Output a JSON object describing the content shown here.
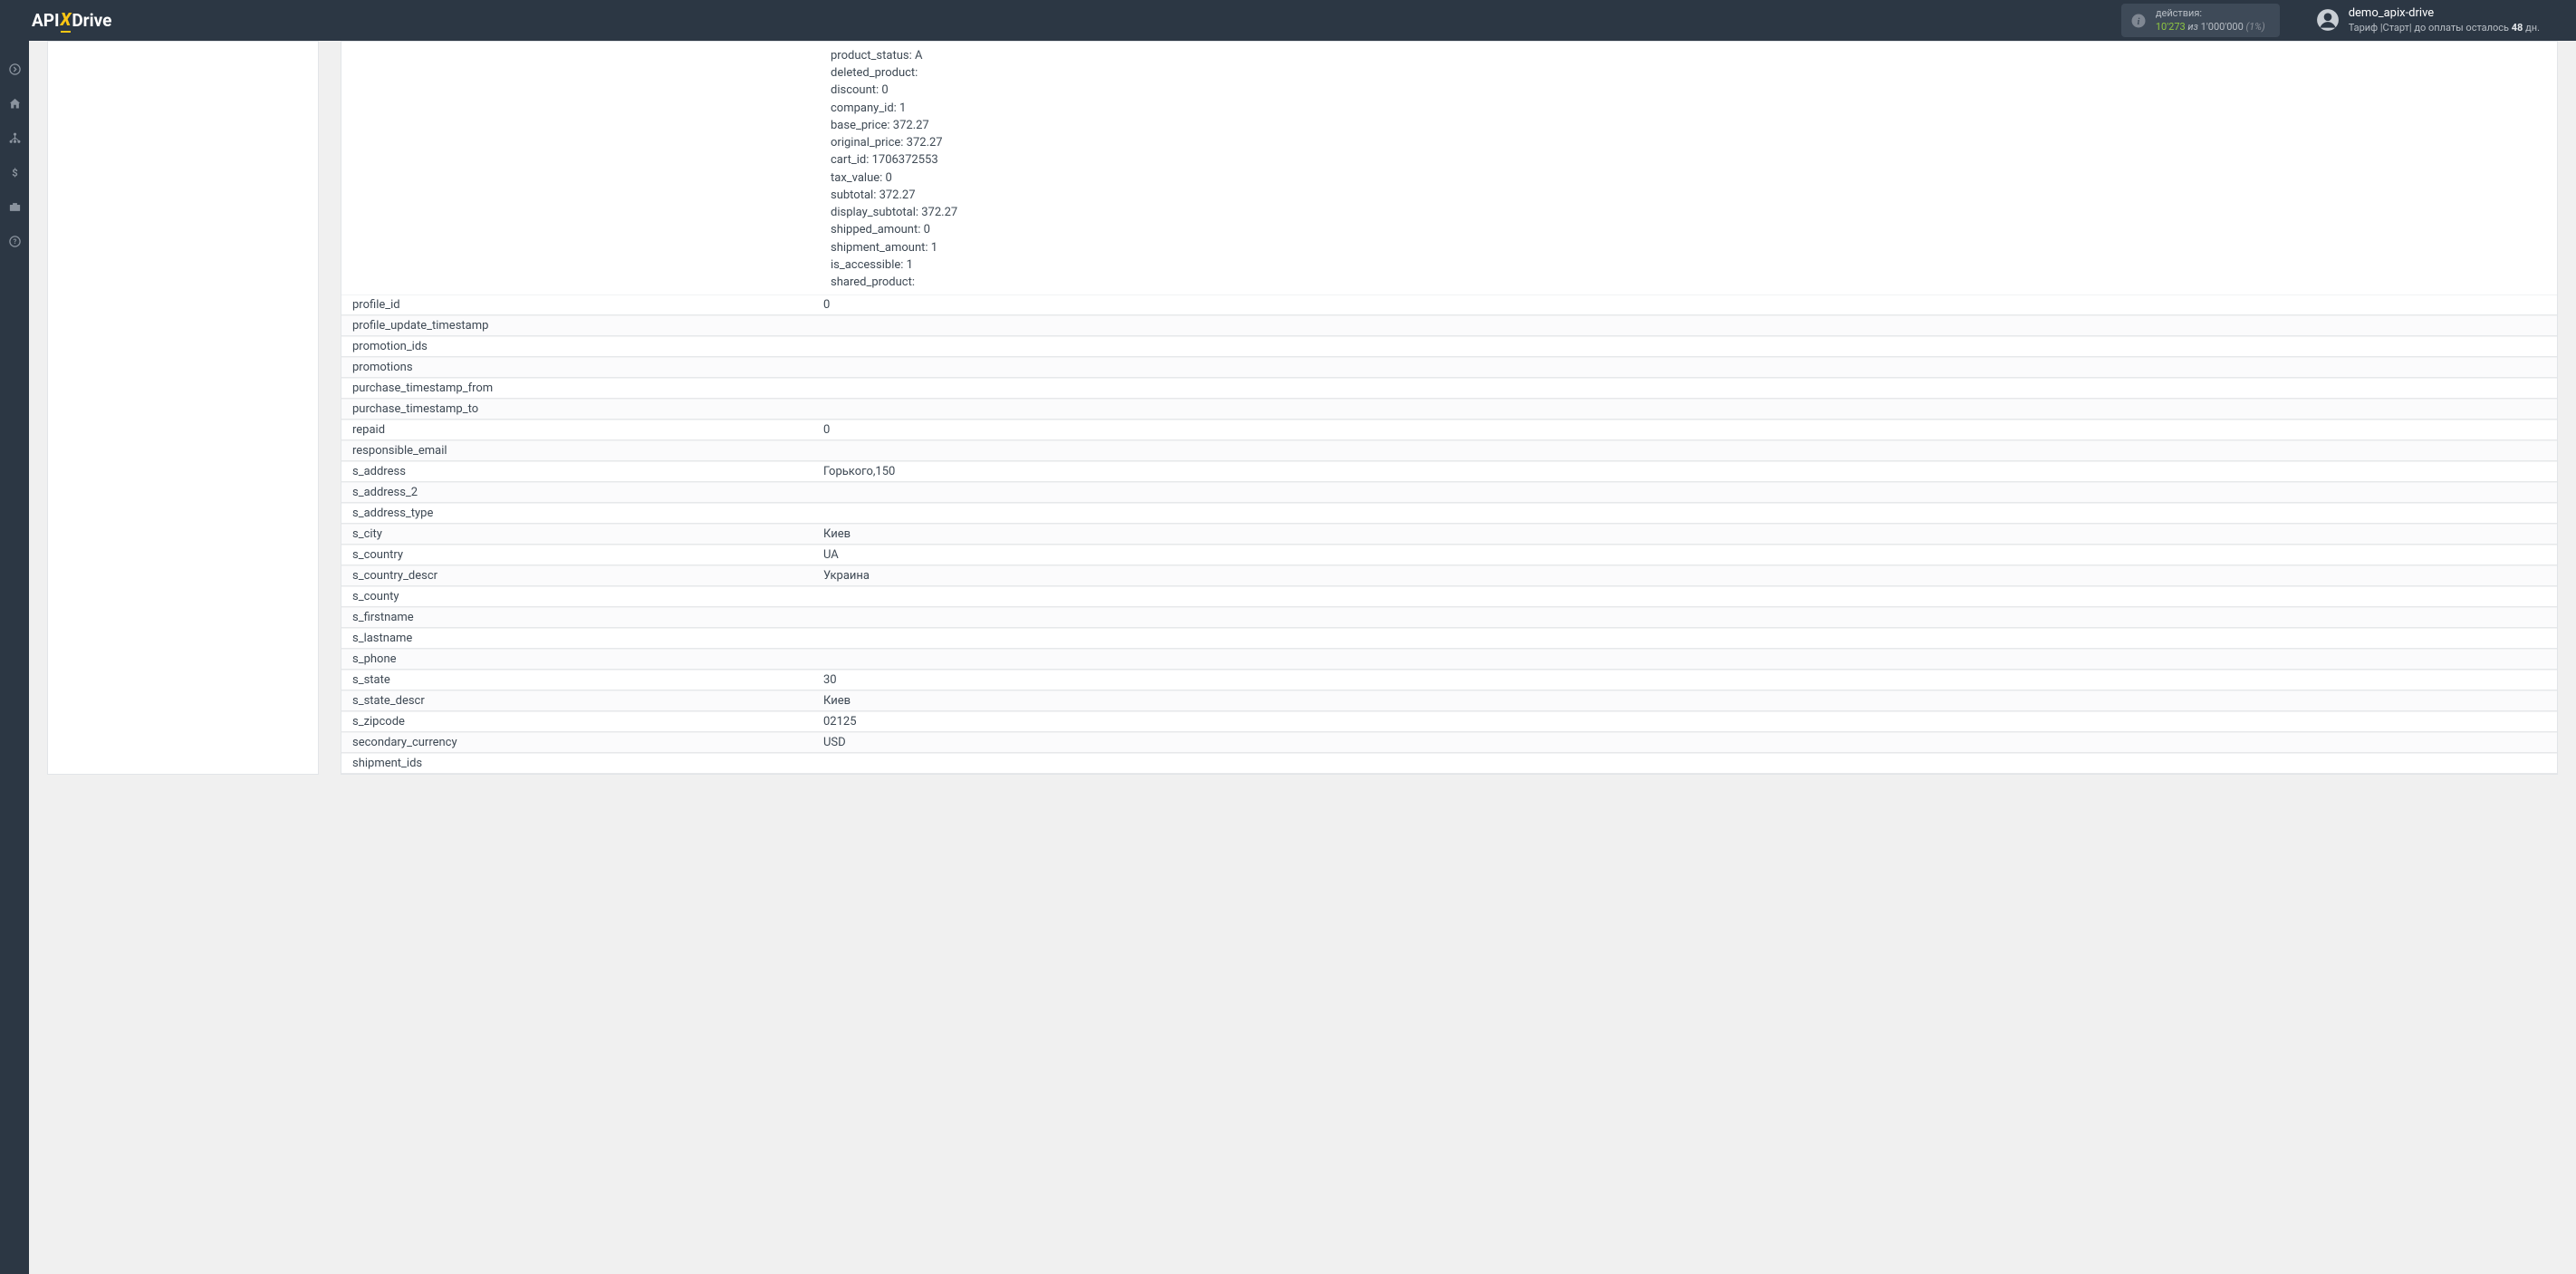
{
  "header": {
    "logo": {
      "part1": "API",
      "part2": "X",
      "part3": "Drive"
    },
    "actions": {
      "label": "действия:",
      "count": "10'273",
      "of": " из ",
      "total": "1'000'000",
      "pct": " (1%)"
    },
    "user": {
      "name": "demo_apix-drive",
      "tariff_pre": "Тариф |Старт| до оплаты осталось ",
      "tariff_days": "48",
      "tariff_post": " дн."
    }
  },
  "product_details": [
    "product_status: A",
    "deleted_product:",
    "discount: 0",
    "company_id: 1",
    "base_price: 372.27",
    "original_price: 372.27",
    "cart_id: 1706372553",
    "tax_value: 0",
    "subtotal: 372.27",
    "display_subtotal: 372.27",
    "shipped_amount: 0",
    "shipment_amount: 1",
    "is_accessible: 1",
    "shared_product:"
  ],
  "rows": [
    {
      "key": "profile_id",
      "val": "0"
    },
    {
      "key": "profile_update_timestamp",
      "val": ""
    },
    {
      "key": "promotion_ids",
      "val": ""
    },
    {
      "key": "promotions",
      "val": ""
    },
    {
      "key": "purchase_timestamp_from",
      "val": ""
    },
    {
      "key": "purchase_timestamp_to",
      "val": ""
    },
    {
      "key": "repaid",
      "val": "0"
    },
    {
      "key": "responsible_email",
      "val": ""
    },
    {
      "key": "s_address",
      "val": "Горького,150"
    },
    {
      "key": "s_address_2",
      "val": ""
    },
    {
      "key": "s_address_type",
      "val": ""
    },
    {
      "key": "s_city",
      "val": "Киев"
    },
    {
      "key": "s_country",
      "val": "UA"
    },
    {
      "key": "s_country_descr",
      "val": "Украина"
    },
    {
      "key": "s_county",
      "val": ""
    },
    {
      "key": "s_firstname",
      "val": ""
    },
    {
      "key": "s_lastname",
      "val": ""
    },
    {
      "key": "s_phone",
      "val": ""
    },
    {
      "key": "s_state",
      "val": "30"
    },
    {
      "key": "s_state_descr",
      "val": "Киев"
    },
    {
      "key": "s_zipcode",
      "val": "02125"
    },
    {
      "key": "secondary_currency",
      "val": "USD"
    },
    {
      "key": "shipment_ids",
      "val": ""
    }
  ]
}
